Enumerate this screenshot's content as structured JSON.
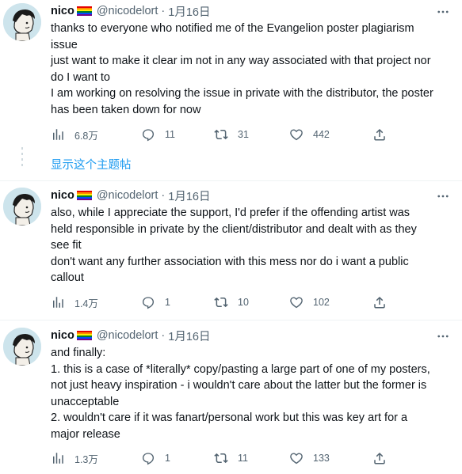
{
  "colors": {
    "accent": "#1d9bf0",
    "muted": "#536471",
    "text": "#0f1419"
  },
  "tweets": [
    {
      "name": "nico",
      "flag": "pride-flag",
      "handle": "@nicodelort",
      "dot": "·",
      "date": "1月16日",
      "lines": [
        "thanks to everyone who notified me of the Evangelion poster plagiarism",
        "issue",
        "just want to make it clear im not in any way associated with that project nor",
        "do I want to",
        "I am working on resolving the issue in private with the distributor, the poster",
        "has been taken down for now"
      ],
      "views": "6.8万",
      "replies": "11",
      "retweets": "31",
      "likes": "442"
    },
    {
      "name": "nico",
      "flag": "pride-flag",
      "handle": "@nicodelort",
      "dot": "·",
      "date": "1月16日",
      "lines": [
        "also, while I appreciate the support, I'd prefer if the offending artist was",
        "held responsible in private by the client/distributor and dealt with as they",
        "see fit",
        "don't want any further association with this mess nor do i want a public",
        "callout"
      ],
      "views": "1.4万",
      "replies": "1",
      "retweets": "10",
      "likes": "102"
    },
    {
      "name": "nico",
      "flag": "pride-flag",
      "handle": "@nicodelort",
      "dot": "·",
      "date": "1月16日",
      "lines": [
        "and finally:",
        "1. this is a case of *literally* copy/pasting a large part of one of my posters,",
        "not just heavy inspiration - i wouldn't care about the latter but the former is",
        "unacceptable",
        "2. wouldn't care if it was fanart/personal work but this was key art for a",
        "major release"
      ],
      "views": "1.3万",
      "replies": "1",
      "retweets": "11",
      "likes": "133"
    }
  ],
  "show_thread": "显示这个主题帖"
}
